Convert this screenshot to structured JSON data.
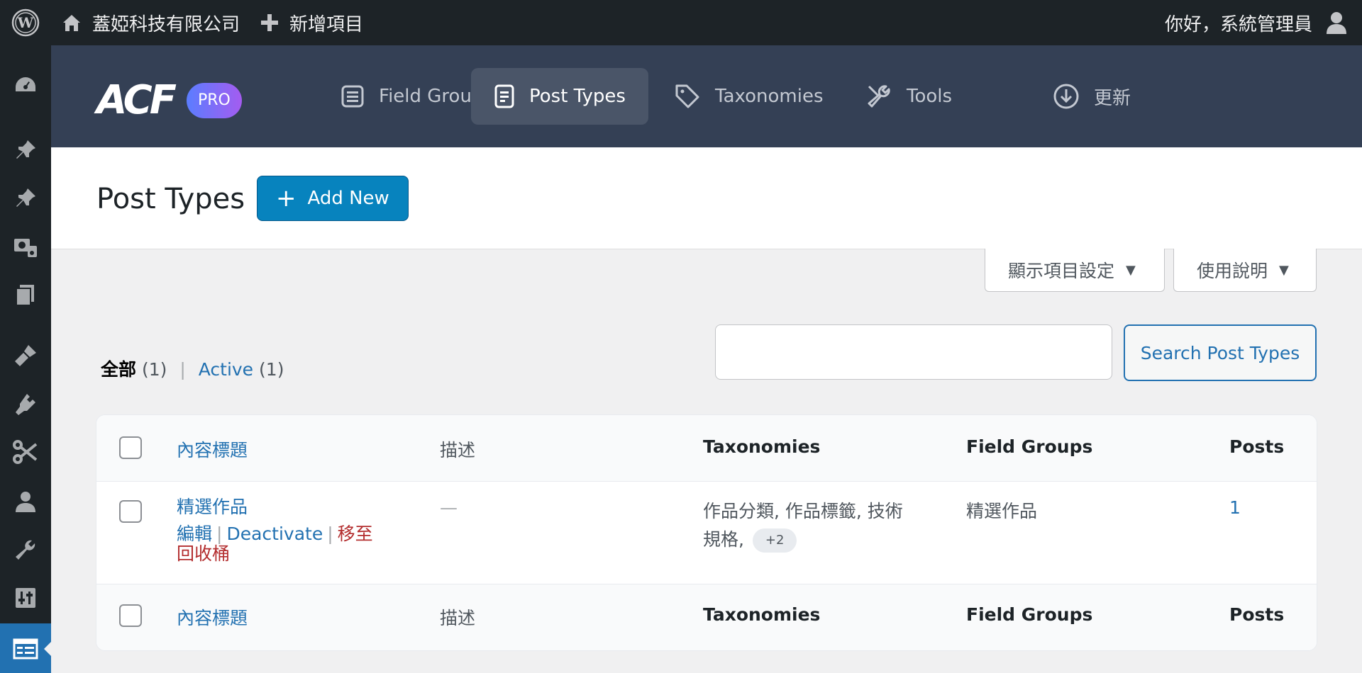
{
  "adminbar": {
    "site_name": "蓋婭科技有限公司",
    "new_item": "新增項目",
    "greeting": "你好，系統管理員"
  },
  "sidebar": {
    "icons": [
      "dashboard-icon",
      "pin-icon",
      "pin-icon",
      "media-icon",
      "pages-icon",
      "appearance-icon",
      "plugins-icon",
      "scissors-icon",
      "users-icon",
      "tools-icon",
      "settings-icon",
      "acf-icon"
    ]
  },
  "acf": {
    "logo": "ACF",
    "pro_badge": "PRO",
    "tabs": [
      {
        "label": "Field Groups",
        "icon": "list-icon"
      },
      {
        "label": "Post Types",
        "icon": "document-icon"
      },
      {
        "label": "Taxonomies",
        "icon": "tag-icon"
      },
      {
        "label": "Tools",
        "icon": "tools-icon"
      },
      {
        "label": "更新",
        "icon": "download-icon"
      }
    ],
    "active_tab": "Post Types"
  },
  "page": {
    "title": "Post Types",
    "add_new": "Add New"
  },
  "screen_meta": {
    "screen_options": "顯示項目設定",
    "help": "使用說明"
  },
  "filters": {
    "all_label": "全部",
    "all_count": "(1)",
    "active_label": "Active",
    "active_count": "(1)"
  },
  "search": {
    "value": "",
    "button": "Search Post Types"
  },
  "table": {
    "columns": [
      "內容標題",
      "描述",
      "Taxonomies",
      "Field Groups",
      "Posts"
    ],
    "rows": [
      {
        "title": "精選作品",
        "actions": {
          "edit": "編輯",
          "deactivate": "Deactivate",
          "trash": "移至回收桶"
        },
        "description": "—",
        "taxonomies": "作品分類, 作品標籤, 技術規格,",
        "taxonomies_more": "+2",
        "field_groups": "精選作品",
        "posts": "1"
      }
    ]
  },
  "colors": {
    "adminbar_bg": "#1d2327",
    "acf_header_bg": "#344055",
    "primary_blue": "#0783be",
    "link_blue": "#2271b1",
    "trash_red": "#b32d2e"
  }
}
